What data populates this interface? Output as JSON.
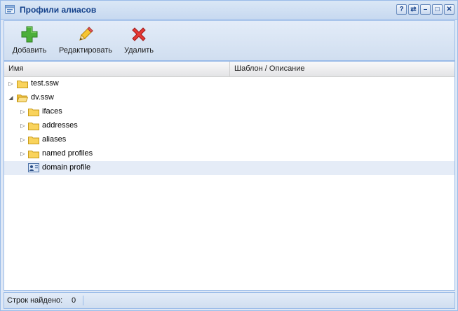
{
  "window": {
    "title": "Профили алиасов",
    "title_icon": "window-app-icon"
  },
  "title_tools": [
    {
      "name": "help-icon",
      "glyph": "?"
    },
    {
      "name": "refresh-icon",
      "glyph": "⇄"
    },
    {
      "name": "minimize-icon",
      "glyph": "–"
    },
    {
      "name": "maximize-icon",
      "glyph": "□"
    },
    {
      "name": "close-icon",
      "glyph": "✕"
    }
  ],
  "toolbar": {
    "add_label": "Добавить",
    "edit_label": "Редактировать",
    "delete_label": "Удалить"
  },
  "grid": {
    "columns": [
      "Имя",
      "Шаблон / Описание"
    ],
    "rows": [
      {
        "label": "test.ssw",
        "expanded": false,
        "icon": "folder-icon"
      },
      {
        "label": "dv.ssw",
        "expanded": true,
        "icon": "folder-open-icon"
      },
      {
        "label": "ifaces",
        "expanded": false,
        "icon": "folder-icon"
      },
      {
        "label": "addresses",
        "expanded": false,
        "icon": "folder-icon"
      },
      {
        "label": "aliases",
        "expanded": false,
        "icon": "folder-icon"
      },
      {
        "label": "named profiles",
        "expanded": false,
        "icon": "folder-icon"
      },
      {
        "label": "domain profile",
        "icon": "profile-card-icon",
        "selected": true
      }
    ]
  },
  "status": {
    "label": "Строк найдено:",
    "count": "0"
  },
  "colors": {
    "accent": "#15428b",
    "border": "#99bbe8",
    "selection": "#e5ecf7"
  }
}
